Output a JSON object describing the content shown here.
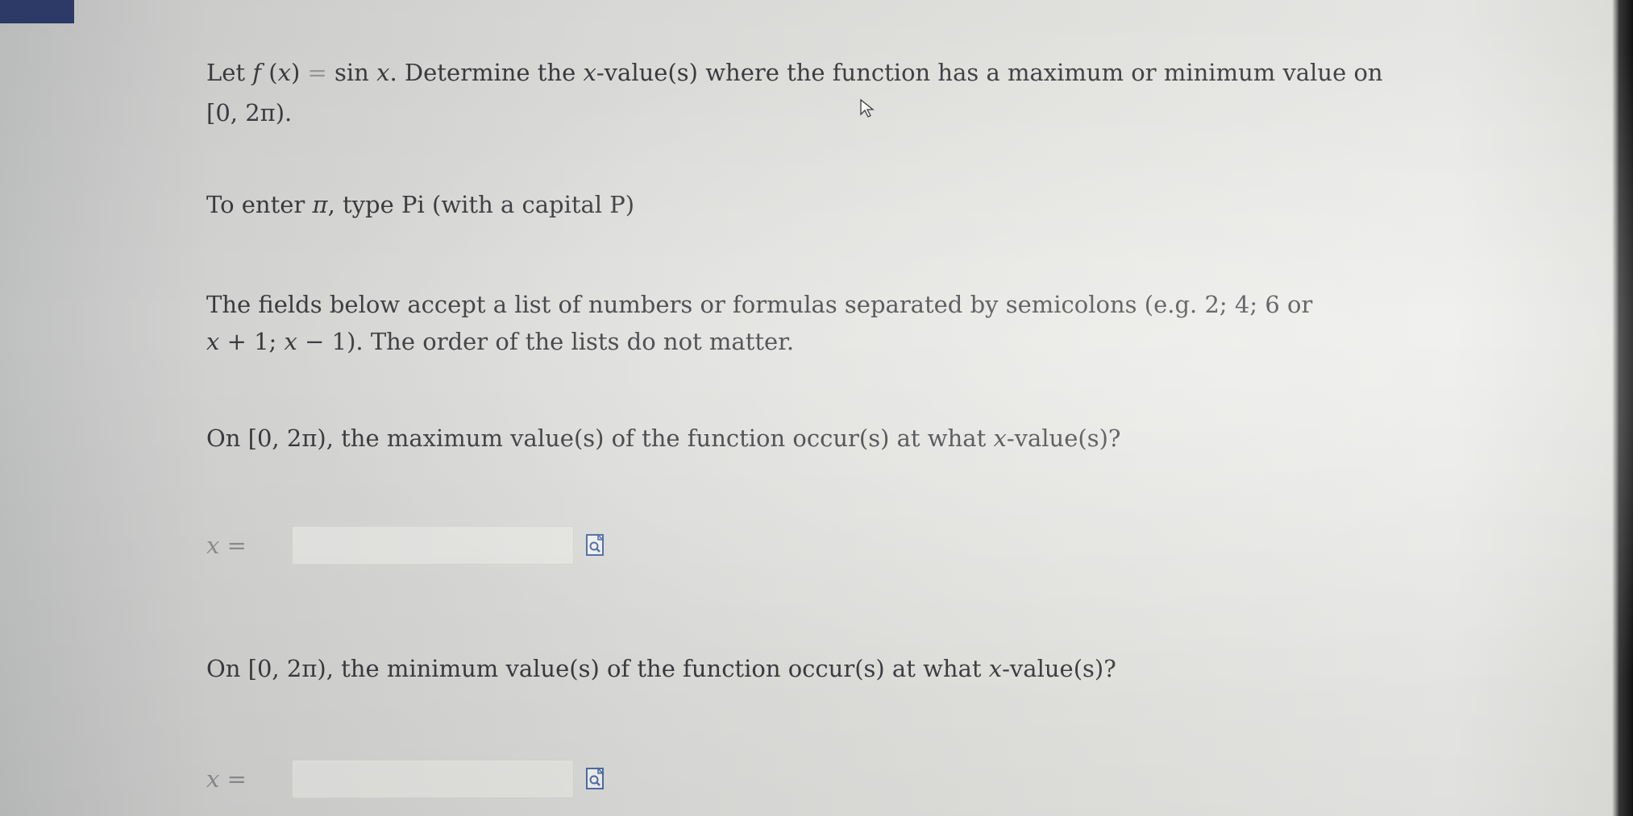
{
  "problem": {
    "intro_1": "Let ",
    "f": "f",
    "open_paren": " (",
    "x1": "x",
    "close_eq": ") ",
    "eq_sign": "=",
    "sin": " sin ",
    "x2": "x",
    "rest_line1": ". Determine the ",
    "x3": "x",
    "rest_line1b": "-value(s) where the function has a maximum or minimum value on",
    "line2": "[0, 2π)."
  },
  "pi_hint": {
    "text_a": "To enter ",
    "pi": "π",
    "text_b": ", type Pi (with a capital P)"
  },
  "fields_note": {
    "line1": "The  fields  below  accept  a  list  of  numbers  or  formulas  separated  by  semicolons  (e.g.  2;  4;  6  or",
    "line2_a": "x",
    "line2_b": " + 1;  ",
    "line2_c": "x",
    "line2_d": " − 1). The order of the lists do not matter."
  },
  "question_max": {
    "text_a": "On [0, 2π), the maximum value(s) of the function occur(s) at what ",
    "x": "x",
    "text_b": "-value(s)?"
  },
  "question_min": {
    "text_a": "On [0, 2π), the minimum value(s) of the function occur(s) at what ",
    "x": "x",
    "text_b": "-value(s)?"
  },
  "answer_max": {
    "label": "x =",
    "value": "",
    "preview_icon": "preview-icon"
  },
  "answer_min": {
    "label": "x =",
    "value": "",
    "preview_icon": "preview-icon"
  },
  "colors": {
    "text": "#3b3b3f",
    "badge": "#2e3b6a",
    "input_border": "#d7d7d4",
    "icon_blue": "#4f6fa8"
  }
}
